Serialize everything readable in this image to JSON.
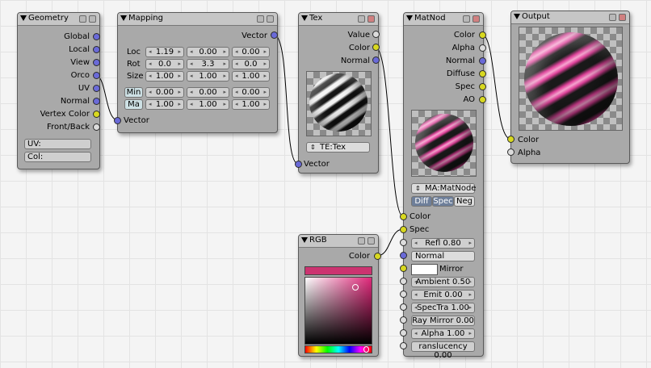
{
  "geometry": {
    "title": "Geometry",
    "outputs": [
      "Global",
      "Local",
      "View",
      "Orco",
      "UV",
      "Normal",
      "Vertex Color",
      "Front/Back"
    ],
    "uv_label": "UV:",
    "col_label": "Col:"
  },
  "mapping": {
    "title": "Mapping",
    "vector_out": "Vector",
    "vector_in": "Vector",
    "rows": [
      {
        "label": "Loc",
        "values": [
          "1.19",
          "0.00",
          "0.00"
        ]
      },
      {
        "label": "Rot",
        "values": [
          "0.0",
          "3.3",
          "0.0"
        ]
      },
      {
        "label": "Size",
        "values": [
          "1.00",
          "1.00",
          "1.00"
        ]
      }
    ],
    "min_label": "Min",
    "max_label": "Ma",
    "min_values": [
      "0.00",
      "0.00",
      "0.00"
    ],
    "max_values": [
      "1.00",
      "1.00",
      "1.00"
    ]
  },
  "tex": {
    "title": "Tex",
    "outputs": [
      "Value",
      "Color",
      "Normal"
    ],
    "texture_select": "TE:Tex",
    "vector_in": "Vector"
  },
  "matnode": {
    "title": "MatNod",
    "outputs": [
      "Color",
      "Alpha",
      "Normal",
      "Diffuse",
      "Spec",
      "AO"
    ],
    "material_select": "MA:MatNode",
    "toggles": [
      {
        "label": "Diff",
        "on": true
      },
      {
        "label": "Spec",
        "on": true
      },
      {
        "label": "Neg",
        "on": false
      }
    ],
    "inputs": [
      "Color",
      "Spec"
    ],
    "refl": "Refl 0.80",
    "normal": "Normal",
    "mirror": "Mirror",
    "ambient": "Ambient 0.50",
    "emit": "Emit 0.00",
    "spectra": "SpecTra 1.00",
    "raymirror": "Ray Mirror 0.00",
    "alpha": "Alpha 1.00",
    "translucency": "ranslucency 0.00"
  },
  "output": {
    "title": "Output",
    "inputs": [
      "Color",
      "Alpha"
    ]
  },
  "rgb": {
    "title": "RGB",
    "output": "Color",
    "color": "#cc3370"
  },
  "colors": {
    "vector_socket": "#6a6ad8",
    "color_socket": "#d8d820",
    "value_socket": "#dcdcdc",
    "node_body": "#a9a9a9",
    "stripe_pink": "#e0409a"
  }
}
